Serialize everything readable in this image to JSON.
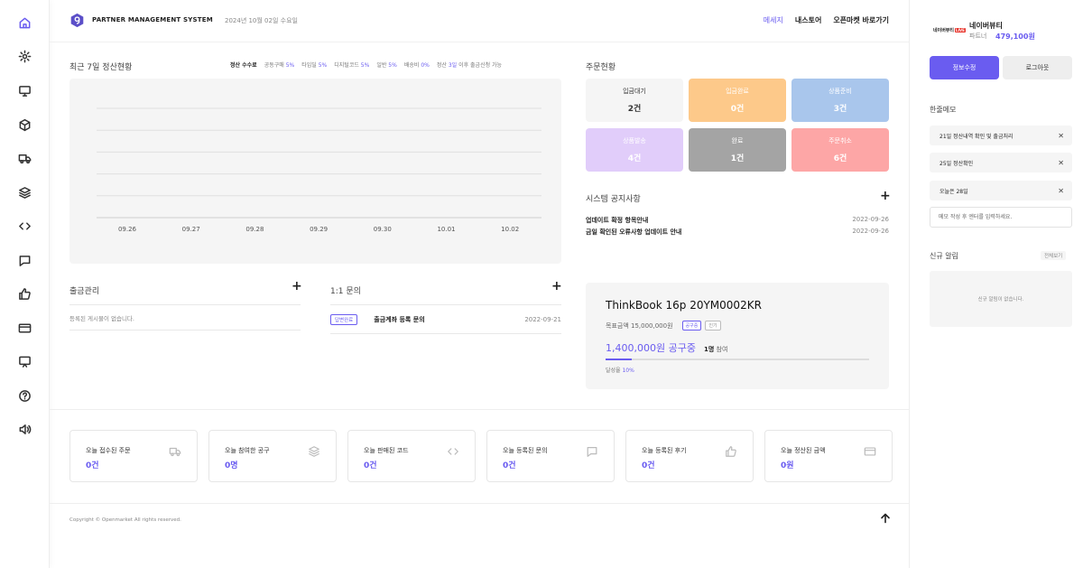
{
  "header": {
    "brand": "PARTNER MANAGEMENT SYSTEM",
    "date": "2024년 10월 02일 수요일",
    "nav": [
      "메세지",
      "내스토어",
      "오픈마켓 바로가기"
    ]
  },
  "chart_section": {
    "title": "최근 7일 정산현황",
    "legend": [
      {
        "label": "정산 수수료",
        "value": ""
      },
      {
        "label": "공동구매",
        "value": "5%"
      },
      {
        "label": "타임딜",
        "value": "5%"
      },
      {
        "label": "디지털코드",
        "value": "5%"
      },
      {
        "label": "일반",
        "value": "5%"
      },
      {
        "label": "배송비",
        "value": "0%"
      }
    ],
    "note_prefix": "정산",
    "note_highlight": "3일",
    "note_suffix": "이후 출금신청 가능"
  },
  "chart_data": {
    "type": "line",
    "categories": [
      "09.26",
      "09.27",
      "09.28",
      "09.29",
      "09.30",
      "10.01",
      "10.02"
    ],
    "series": [],
    "grid": true
  },
  "orders": {
    "title": "주문현황",
    "cards": [
      {
        "label": "입금대기",
        "value": "2건",
        "bg": "#f5f5f5",
        "fg": "#333"
      },
      {
        "label": "입금완료",
        "value": "0건",
        "bg": "#fdc98a",
        "fg": "#fff"
      },
      {
        "label": "상품준비",
        "value": "3건",
        "bg": "#a9c6ec",
        "fg": "#fff"
      },
      {
        "label": "상품발송",
        "value": "4건",
        "bg": "#e1cdfa",
        "fg": "#fff"
      },
      {
        "label": "완료",
        "value": "1건",
        "bg": "#a4a4a4",
        "fg": "#fff"
      },
      {
        "label": "주문취소",
        "value": "6건",
        "bg": "#fda6a6",
        "fg": "#fff"
      }
    ]
  },
  "notices": {
    "title": "시스템 공지사항",
    "items": [
      {
        "title": "업데이트 확정 항목안내",
        "date": "2022-09-26"
      },
      {
        "title": "금일 확인된 오류사항 업데이트 안내",
        "date": "2022-09-26"
      }
    ]
  },
  "withdraw": {
    "title": "출금관리",
    "empty": "등록된 게시물이 없습니다."
  },
  "inquiry": {
    "title": "1:1 문의",
    "items": [
      {
        "badge": "답변완료",
        "title": "출금계좌 등록 문의",
        "date": "2022-09-21"
      }
    ]
  },
  "product": {
    "name": "ThinkBook 16p 20YM0002KR",
    "goal": "목표금액 15,000,000원",
    "tag1": "공구중",
    "tag2": "인기",
    "amount": "1,400,000원 공구중",
    "participants_count": "1명",
    "participants_suffix": "참여",
    "rate_label": "달성율",
    "rate_value": "10%",
    "progress": 0.1
  },
  "today": [
    {
      "label": "오늘 접수된 주문",
      "value": "0건",
      "icon": "truck-icon"
    },
    {
      "label": "오늘 참여한 공구",
      "value": "0명",
      "icon": "layers-icon"
    },
    {
      "label": "오늘 판매된 코드",
      "value": "0건",
      "icon": "code-icon"
    },
    {
      "label": "오늘 등록된 문의",
      "value": "0건",
      "icon": "chat-icon"
    },
    {
      "label": "오늘 등록된 후기",
      "value": "0건",
      "icon": "thumbs-up-icon"
    },
    {
      "label": "오늘 정산된 금액",
      "value": "0원",
      "icon": "card-icon"
    }
  ],
  "footer": {
    "copyright": "Copyright © Openmarket All rights reserved."
  },
  "profile": {
    "logo_text": "네이버뷰티",
    "logo_badge": "LIVE",
    "name": "네이버뷰티",
    "role": "파트너",
    "points": "479,100원",
    "edit_label": "정보수정",
    "logout_label": "로그아웃"
  },
  "memo": {
    "title": "한줄메모",
    "items": [
      "21일 정산내역 확인 및 출금처리",
      "25일 정산확인",
      "오늘은 28일"
    ],
    "placeholder": "메모 작성 후 엔터를 입력하세요."
  },
  "alerts": {
    "title": "신규 알림",
    "view_all": "전체보기",
    "empty": "신규 알림이 없습니다."
  },
  "colors": {
    "accent": "#6a5cf0"
  }
}
